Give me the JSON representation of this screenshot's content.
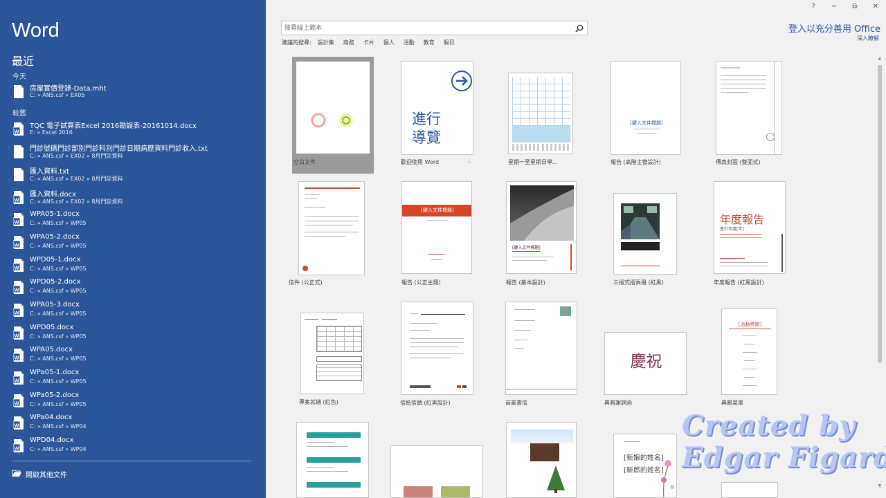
{
  "app_title": "Word",
  "recent_heading": "最近",
  "groups": {
    "today": "今天",
    "older": "較舊"
  },
  "recent_files": [
    {
      "name": "房屋實價登錄-Data.mht",
      "path": "C: » ANS.csf » EX05",
      "icon": "generic-file-icon"
    },
    {
      "name": "TQC 電子試算表Excel 2016勘誤表-20161014.docx",
      "path": "E: » Excel 2016",
      "icon": "word-doc-icon"
    },
    {
      "name": "門診號碼門診部別門診科別門診日期病歷資料門診收入.txt",
      "path": "C: » ANS.csf » EX02 » 8月門診資料",
      "icon": "generic-file-icon"
    },
    {
      "name": "匯入資料.txt",
      "path": "C: » ANS.csf » EX02 » 8月門診資料",
      "icon": "generic-file-icon"
    },
    {
      "name": "匯入資料.docx",
      "path": "C: » ANS.csf » EX02 » 8月門診資料",
      "icon": "word-doc-icon"
    },
    {
      "name": "WPA05-1.docx",
      "path": "C: » ANS.csf » WP05",
      "icon": "word-doc-icon"
    },
    {
      "name": "WPA05-2.docx",
      "path": "C: » ANS.csf » WP05",
      "icon": "word-doc-icon"
    },
    {
      "name": "WPD05-1.docx",
      "path": "C: » ANS.csf » WP05",
      "icon": "word-doc-icon"
    },
    {
      "name": "WPD05-2.docx",
      "path": "C: » ANS.csf » WP05",
      "icon": "word-doc-icon"
    },
    {
      "name": "WPA05-3.docx",
      "path": "C: » ANS.csf » WP05",
      "icon": "word-doc-icon"
    },
    {
      "name": "WPD05.docx",
      "path": "C: » ANS.csf » WP05",
      "icon": "word-doc-icon"
    },
    {
      "name": "WPA05.docx",
      "path": "C: » ANS.csf » WP05",
      "icon": "word-doc-icon"
    },
    {
      "name": "WPa05-1.docx",
      "path": "C: » ANS.csf » WP05",
      "icon": "word-doc-icon"
    },
    {
      "name": "WPa05-2.docx",
      "path": "C: » ANS.csf » WP05",
      "icon": "word-doc-icon"
    },
    {
      "name": "WPa04.docx",
      "path": "C: » ANS.csf » WP04",
      "icon": "word-doc-icon"
    },
    {
      "name": "WPD04.docx",
      "path": "C: » ANS.csf » WP04",
      "icon": "word-doc-icon"
    }
  ],
  "open_other": "開啟其他文件",
  "window_controls": [
    "?",
    "−",
    "⧉",
    "✕"
  ],
  "search": {
    "placeholder": "搜尋線上範本"
  },
  "suggested": {
    "label": "建議的搜尋:",
    "items": [
      "設計集",
      "商務",
      "卡片",
      "個人",
      "活動",
      "教育",
      "假日"
    ]
  },
  "signin": "登入以充分善用 Office",
  "learn_more": "深入瞭解",
  "templates": {
    "blank": "空白文件",
    "welcome": "歡迎使用 Word",
    "welcome_text_1": "進行",
    "welcome_text_2": "導覽",
    "calendar": "星期一至星期日學...",
    "report_modern": "報告 (高階主管設計)",
    "report_modern_title": "[鍵入文件標題]",
    "cover_page": "傳真封面 (雙面式)",
    "letter_formal": "信件 (公正式)",
    "report_formal": "報告 (公正主題)",
    "report_formal_title": "[鍵入文件標題]",
    "report_basic": "報告 (基本設計)",
    "report_basic_title": "[鍵入文件標題]",
    "brochure": "三摺式摺頁冊 (紅黑)",
    "annual_report": "年度報告 (紅黑設計)",
    "annual_report_title": "年度報告",
    "annual_report_sub": "會計年度[年]",
    "invoice": "專案就緒 (紅色)",
    "letterhead": "信紙信頭 (紅黑設計)",
    "business_letter": "商業書信",
    "celebration": "典雅謝詞函",
    "celebration_text": "慶祝",
    "menu": "典雅菜單",
    "menu_title": "[活動標題]",
    "wedding_1": "[新娘的姓名]",
    "wedding_2": "[新郎的姓名]"
  },
  "watermark": {
    "line1": "Created by",
    "line2": "Edgar Figard"
  },
  "colors": {
    "word_blue": "#2b579a",
    "accent_red": "#d24726"
  }
}
